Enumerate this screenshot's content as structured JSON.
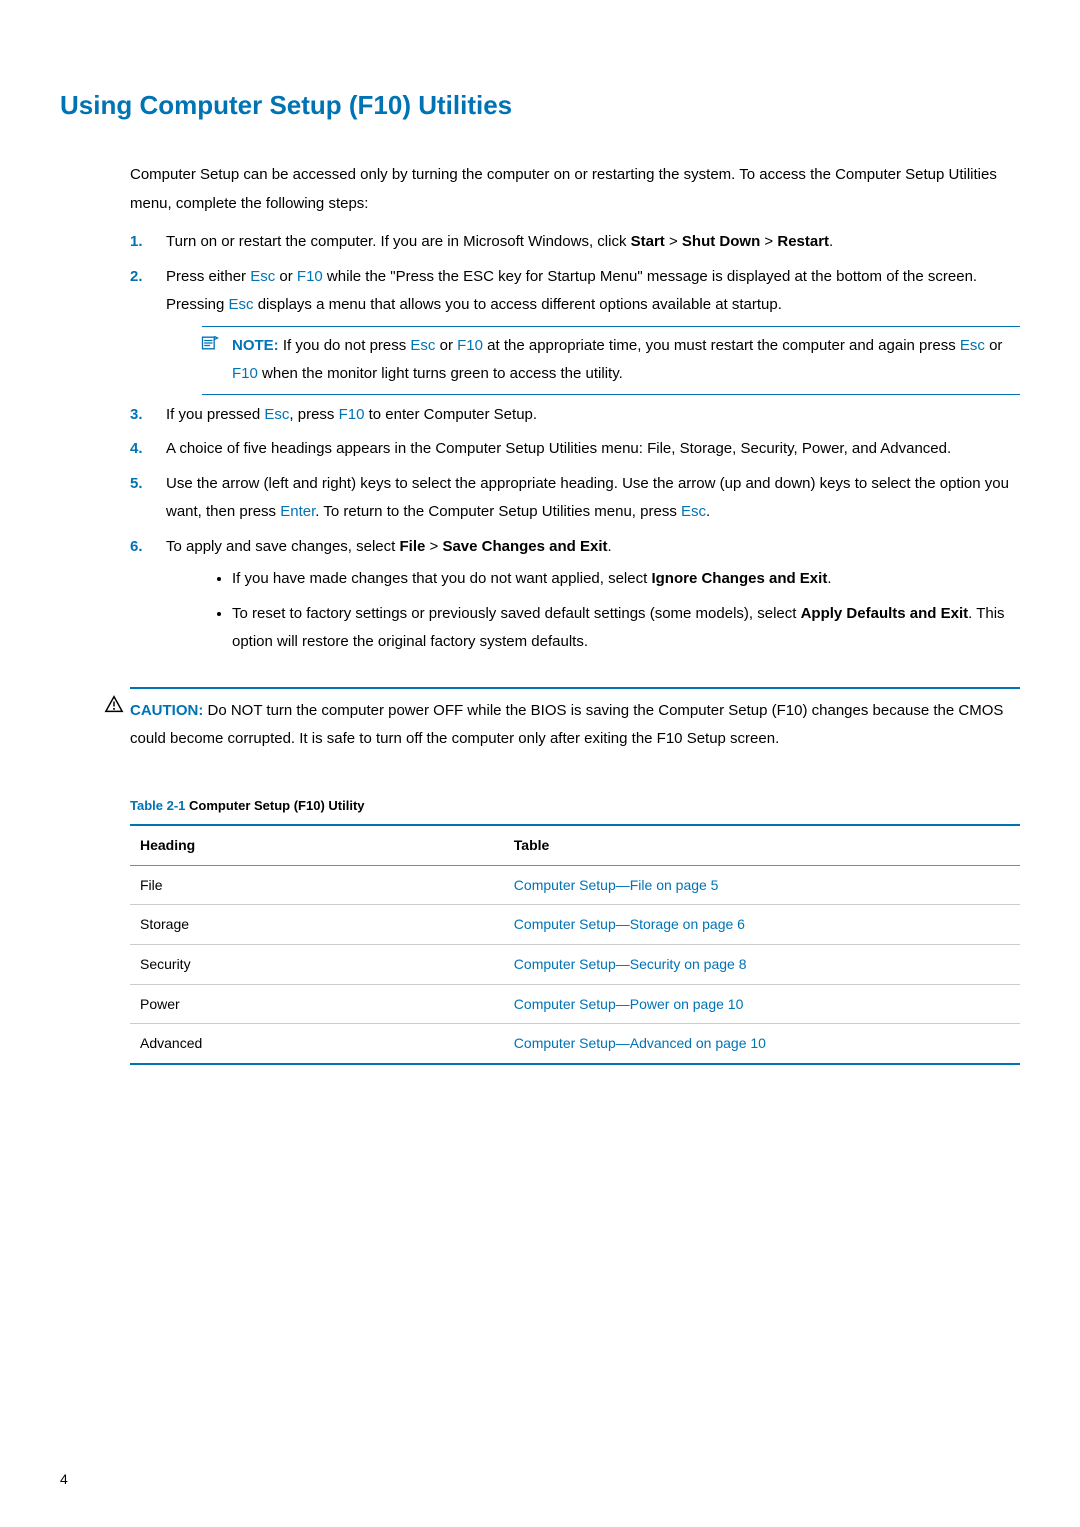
{
  "title": "Using Computer Setup (F10) Utilities",
  "intro": "Computer Setup can be accessed only by turning the computer on or restarting the system. To access the Computer Setup Utilities menu, complete the following steps:",
  "keys": {
    "esc": "Esc",
    "f10": "F10",
    "enter": "Enter"
  },
  "steps": {
    "s1": {
      "num": "1.",
      "t1": "Turn on or restart the computer. If you are in Microsoft Windows, click ",
      "b1": "Start",
      "gt1": " > ",
      "b2": "Shut Down",
      "gt2": " > ",
      "b3": "Restart",
      "end": "."
    },
    "s2": {
      "num": "2.",
      "t1": "Press either ",
      "t2": " or ",
      "t3": " while the \"Press the ESC key for Startup Menu\"  message is displayed at the bottom of the screen.",
      "t4": "Pressing ",
      "t5": " displays a menu that allows you to access different options available at startup."
    },
    "note": {
      "label": "NOTE:",
      "t1": " If you do not press ",
      "t2": " or ",
      "t3": " at the appropriate time, you must restart the computer and again press ",
      "t4": " or ",
      "t5": " when the monitor light turns green to access the utility."
    },
    "s3": {
      "num": "3.",
      "t1": "If you pressed ",
      "t2": ", press ",
      "t3": " to enter Computer Setup."
    },
    "s4": {
      "num": "4.",
      "t": "A choice of five headings appears in the Computer Setup Utilities menu: File, Storage, Security, Power, and Advanced."
    },
    "s5": {
      "num": "5.",
      "t1": "Use the arrow (left and right) keys to select the appropriate heading. Use the arrow (up and down) keys to select the option you want, then press ",
      "t2": ". To return to the Computer Setup Utilities menu, press ",
      "t3": "."
    },
    "s6": {
      "num": "6.",
      "t1": "To apply and save changes, select ",
      "b1": "File",
      "gt": " > ",
      "b2": "Save Changes and Exit",
      "end": ".",
      "sub1a": "If you have made changes that you do not want applied, select ",
      "sub1b": "Ignore Changes and Exit",
      "sub1end": ".",
      "sub2a": "To reset to factory settings or previously saved default settings (some models), select ",
      "sub2b": "Apply Defaults and Exit",
      "sub2c": ". This option will restore the original factory system defaults."
    }
  },
  "caution": {
    "label": "CAUTION:",
    "text": " Do NOT turn the computer power OFF while the BIOS is saving the Computer Setup (F10) changes because the CMOS could become corrupted. It is safe to turn off the computer only after exiting the F10 Setup screen."
  },
  "table": {
    "num": "Table 2-1",
    "caption": "  Computer Setup (F10) Utility",
    "headers": {
      "h1": "Heading",
      "h2": "Table"
    },
    "rows": [
      {
        "heading": "File",
        "link": "Computer Setup—File on page 5"
      },
      {
        "heading": "Storage",
        "link": "Computer Setup—Storage on page 6"
      },
      {
        "heading": "Security",
        "link": "Computer Setup—Security on page 8"
      },
      {
        "heading": "Power",
        "link": "Computer Setup—Power on page 10"
      },
      {
        "heading": "Advanced",
        "link": "Computer Setup—Advanced on page 10"
      }
    ]
  },
  "page_number": "4"
}
